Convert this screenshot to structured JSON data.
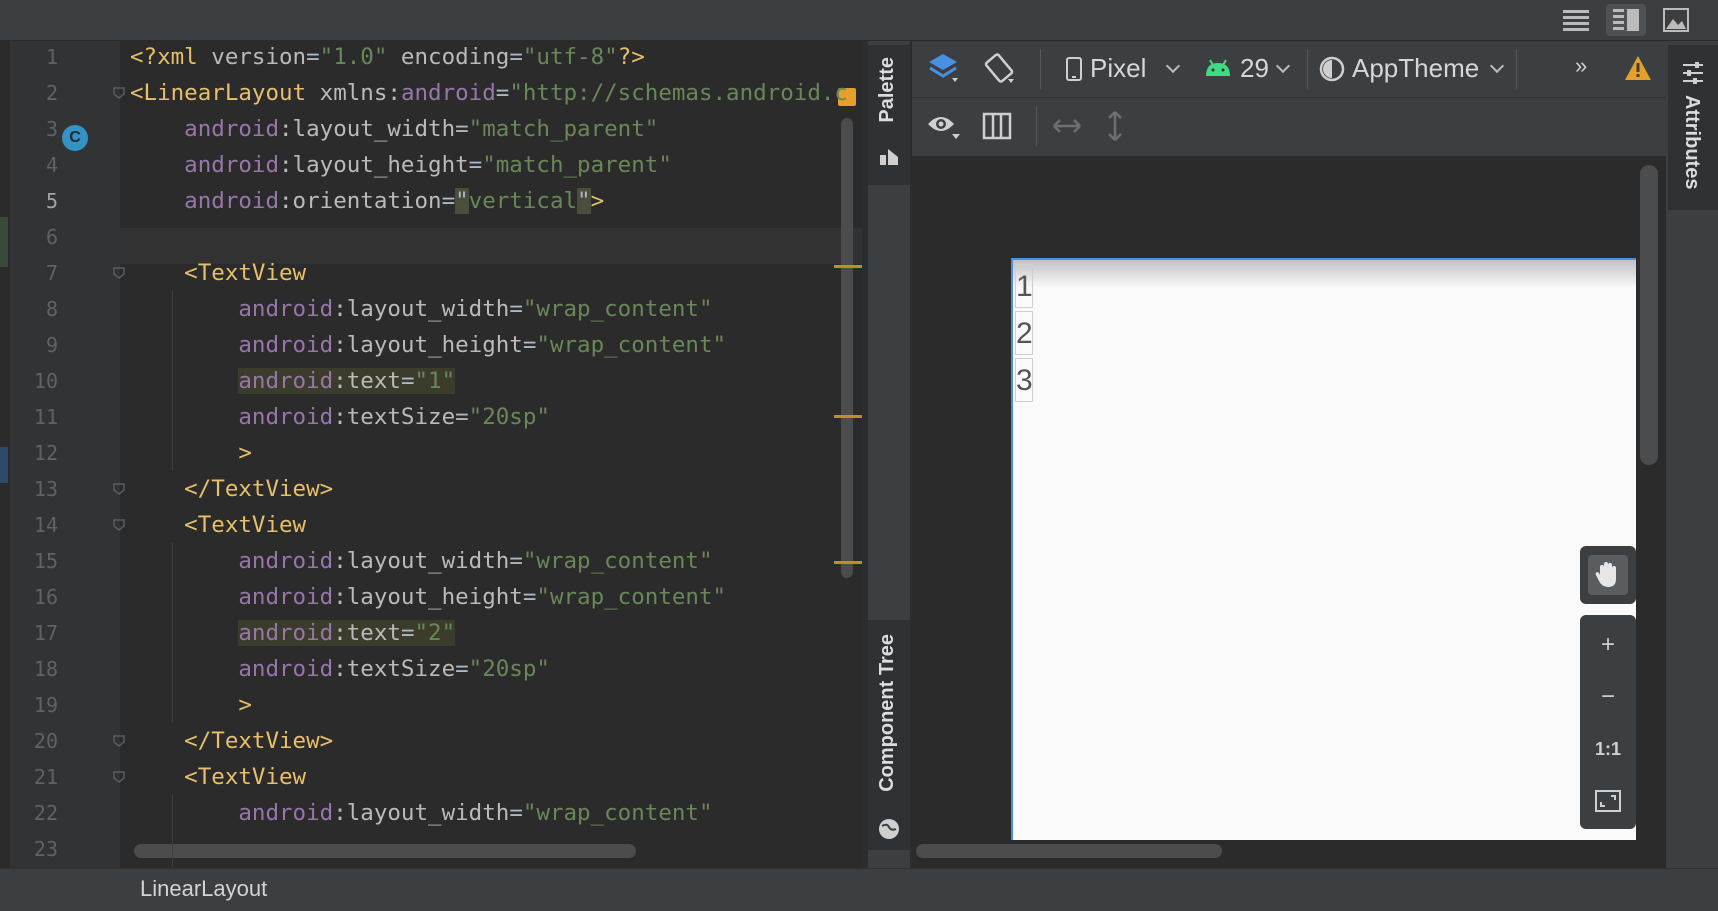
{
  "editor": {
    "line_numbers": [
      "1",
      "2",
      "3",
      "4",
      "5",
      "6",
      "7",
      "8",
      "9",
      "10",
      "11",
      "12",
      "13",
      "14",
      "15",
      "16",
      "17",
      "18",
      "19",
      "20",
      "21",
      "22",
      "23"
    ],
    "gutter_badge": "C",
    "lines": [
      [
        {
          "t": "tag",
          "s": "<?xml "
        },
        {
          "t": "attr",
          "s": "version"
        },
        {
          "t": "punct",
          "s": "="
        },
        {
          "t": "val",
          "s": "\"1.0\""
        },
        {
          "t": "attr",
          "s": " encoding"
        },
        {
          "t": "punct",
          "s": "="
        },
        {
          "t": "val",
          "s": "\"utf-8\""
        },
        {
          "t": "tag",
          "s": "?>"
        }
      ],
      [
        {
          "t": "tag",
          "s": "<LinearLayout "
        },
        {
          "t": "attr",
          "s": "xmlns:"
        },
        {
          "t": "ns",
          "s": "android"
        },
        {
          "t": "punct",
          "s": "="
        },
        {
          "t": "val",
          "s": "\"http://schemas.android.c"
        }
      ],
      [
        {
          "t": "ns",
          "s": "    android"
        },
        {
          "t": "attr",
          "s": ":layout_width"
        },
        {
          "t": "punct",
          "s": "="
        },
        {
          "t": "val",
          "s": "\"match_parent\""
        }
      ],
      [
        {
          "t": "ns",
          "s": "    android"
        },
        {
          "t": "attr",
          "s": ":layout_height"
        },
        {
          "t": "punct",
          "s": "="
        },
        {
          "t": "val",
          "s": "\"match_parent\""
        }
      ],
      [
        {
          "t": "ns",
          "s": "    android"
        },
        {
          "t": "attr",
          "s": ":orientation"
        },
        {
          "t": "punct",
          "s": "="
        },
        {
          "t": "hl2",
          "s": "\""
        },
        {
          "t": "val",
          "s": "vertical"
        },
        {
          "t": "hl2",
          "s": "\""
        },
        {
          "t": "tag",
          "s": ">"
        }
      ],
      [
        {
          "t": "punct",
          "s": ""
        }
      ],
      [
        {
          "t": "tag",
          "s": "    <TextView"
        }
      ],
      [
        {
          "t": "ns",
          "s": "        android"
        },
        {
          "t": "attr",
          "s": ":layout_width"
        },
        {
          "t": "punct",
          "s": "="
        },
        {
          "t": "val",
          "s": "\"wrap_content\""
        }
      ],
      [
        {
          "t": "ns",
          "s": "        android"
        },
        {
          "t": "attr",
          "s": ":layout_height"
        },
        {
          "t": "punct",
          "s": "="
        },
        {
          "t": "val",
          "s": "\"wrap_content\""
        }
      ],
      [
        {
          "t": "punct",
          "s": "        "
        },
        {
          "t": "hlns",
          "s": "android"
        },
        {
          "t": "hlattr",
          "s": ":text"
        },
        {
          "t": "hlpunct",
          "s": "="
        },
        {
          "t": "hlval",
          "s": "\"1\""
        }
      ],
      [
        {
          "t": "ns",
          "s": "        android"
        },
        {
          "t": "attr",
          "s": ":textSize"
        },
        {
          "t": "punct",
          "s": "="
        },
        {
          "t": "val",
          "s": "\"20sp\""
        }
      ],
      [
        {
          "t": "tag",
          "s": "        >"
        }
      ],
      [
        {
          "t": "tag",
          "s": "    </TextView>"
        }
      ],
      [
        {
          "t": "tag",
          "s": "    <TextView"
        }
      ],
      [
        {
          "t": "ns",
          "s": "        android"
        },
        {
          "t": "attr",
          "s": ":layout_width"
        },
        {
          "t": "punct",
          "s": "="
        },
        {
          "t": "val",
          "s": "\"wrap_content\""
        }
      ],
      [
        {
          "t": "ns",
          "s": "        android"
        },
        {
          "t": "attr",
          "s": ":layout_height"
        },
        {
          "t": "punct",
          "s": "="
        },
        {
          "t": "val",
          "s": "\"wrap_content\""
        }
      ],
      [
        {
          "t": "punct",
          "s": "        "
        },
        {
          "t": "hlns",
          "s": "android"
        },
        {
          "t": "hlattr",
          "s": ":text"
        },
        {
          "t": "hlpunct",
          "s": "="
        },
        {
          "t": "hlval",
          "s": "\"2\""
        }
      ],
      [
        {
          "t": "ns",
          "s": "        android"
        },
        {
          "t": "attr",
          "s": ":textSize"
        },
        {
          "t": "punct",
          "s": "="
        },
        {
          "t": "val",
          "s": "\"20sp\""
        }
      ],
      [
        {
          "t": "tag",
          "s": "        >"
        }
      ],
      [
        {
          "t": "tag",
          "s": "    </TextView>"
        }
      ],
      [
        {
          "t": "tag",
          "s": "    <TextView"
        }
      ],
      [
        {
          "t": "ns",
          "s": "        android"
        },
        {
          "t": "attr",
          "s": ":layout_width"
        },
        {
          "t": "punct",
          "s": "="
        },
        {
          "t": "val",
          "s": "\"wrap_content\""
        }
      ],
      [
        {
          "t": "punct",
          "s": ""
        }
      ]
    ]
  },
  "tool_windows": {
    "palette": "Palette",
    "component_tree": "Component Tree",
    "attributes": "Attributes"
  },
  "design_toolbar": {
    "device": "Pixel",
    "api_level": "29",
    "theme": "AppTheme"
  },
  "preview": {
    "text_views": [
      "1",
      "2",
      "3"
    ]
  },
  "zoom": {
    "zoom_in": "+",
    "zoom_out": "−",
    "actual_size": "1:1"
  },
  "status_bar": {
    "breadcrumb": "LinearLayout"
  },
  "colors": {
    "accent": "#4a90e2",
    "warning": "#e3a02b",
    "android_green": "#3ddc84"
  }
}
